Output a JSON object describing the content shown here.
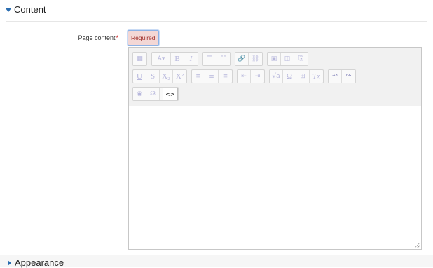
{
  "sections": {
    "content": {
      "label": "Content"
    },
    "appearance": {
      "label": "Appearance"
    }
  },
  "field": {
    "label": "Page content",
    "required_marker": "*",
    "badge": "Required"
  },
  "toolbar": {
    "row1": [
      {
        "name": "toolbar-toggle-icon",
        "glyph": "▦"
      },
      {
        "name": "font-size-icon",
        "glyph": "A▾"
      },
      {
        "name": "bold-icon",
        "glyph": "B"
      },
      {
        "name": "italic-icon",
        "glyph": "I"
      },
      {
        "name": "bullet-list-icon",
        "glyph": "☰"
      },
      {
        "name": "numbered-list-icon",
        "glyph": "☷"
      },
      {
        "name": "link-icon",
        "glyph": "🔗"
      },
      {
        "name": "unlink-icon",
        "glyph": "⛓"
      },
      {
        "name": "image-icon",
        "glyph": "▣"
      },
      {
        "name": "media-icon",
        "glyph": "◫"
      },
      {
        "name": "manage-files-icon",
        "glyph": "⎘"
      }
    ],
    "row2": [
      {
        "name": "underline-icon",
        "glyph": "U"
      },
      {
        "name": "strikethrough-icon",
        "glyph": "S"
      },
      {
        "name": "subscript-icon",
        "glyph": "X₂"
      },
      {
        "name": "superscript-icon",
        "glyph": "X²"
      },
      {
        "name": "align-left-icon",
        "glyph": "≡"
      },
      {
        "name": "align-center-icon",
        "glyph": "≣"
      },
      {
        "name": "align-right-icon",
        "glyph": "≡"
      },
      {
        "name": "outdent-icon",
        "glyph": "⇤"
      },
      {
        "name": "indent-icon",
        "glyph": "⇥"
      },
      {
        "name": "equation-icon",
        "glyph": "√a"
      },
      {
        "name": "special-char-icon",
        "glyph": "Ω"
      },
      {
        "name": "table-icon",
        "glyph": "⊞"
      },
      {
        "name": "clear-formatting-icon",
        "glyph": "Tx"
      },
      {
        "name": "undo-icon",
        "glyph": "↶"
      },
      {
        "name": "redo-icon",
        "glyph": "↷"
      }
    ],
    "row3": [
      {
        "name": "accessibility-checker-icon",
        "glyph": "◉"
      },
      {
        "name": "screenreader-helper-icon",
        "glyph": "☊"
      },
      {
        "name": "html-icon",
        "glyph": "<>"
      }
    ]
  },
  "colors": {
    "accent": "#2a6db0",
    "required": "#cc2222",
    "badge_bg": "#f3d7d5",
    "badge_text": "#a0302c"
  }
}
